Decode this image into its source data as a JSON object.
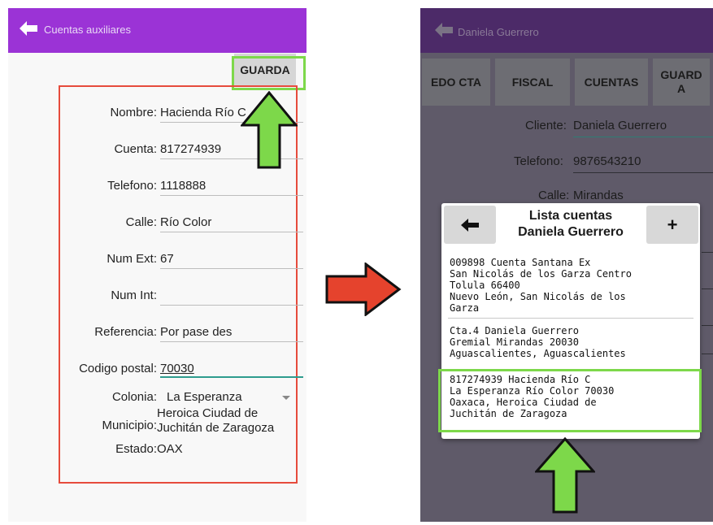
{
  "left_screen": {
    "title": "Cuentas auxiliares",
    "save_button": "GUARDA",
    "fields": [
      {
        "label": "Nombre:",
        "value": "Hacienda Río C"
      },
      {
        "label": "Cuenta:",
        "value": "817274939"
      },
      {
        "label": "Telefono:",
        "value": "1118888"
      },
      {
        "label": "Calle:",
        "value": "Río Color"
      },
      {
        "label": "Num Ext:",
        "value": "67"
      },
      {
        "label": "Num Int:",
        "value": ""
      },
      {
        "label": "Referencia:",
        "value": "Por pase des"
      },
      {
        "label": "Codigo postal:",
        "value": "70030"
      }
    ],
    "colonia": {
      "label": "Colonia:",
      "value": "La Esperanza"
    },
    "municipio": {
      "label": "Municipio:",
      "value_line1": "Heroica Ciudad de",
      "value_line2": "Juchitán de Zaragoza"
    },
    "estado": {
      "label": "Estado:",
      "value": "OAX"
    }
  },
  "right_screen": {
    "title": "Daniela Guerrero",
    "tabs": [
      "EDO CTA",
      "FISCAL",
      "CUENTAS",
      "GUARD A"
    ],
    "fields": [
      {
        "label": "Cliente:",
        "value": "Daniela Guerrero"
      },
      {
        "label": "Telefono:",
        "value": "9876543210"
      },
      {
        "label": "Calle:",
        "value": "Mirandas"
      }
    ],
    "dialog": {
      "title_line1": "Lista cuentas",
      "title_line2": "Daniela Guerrero",
      "back_icon": "arrow-left-icon",
      "add_label": "+",
      "items": [
        "009898 Cuenta Santana Ex\nSan Nicolás de los Garza Centro\nTolula 66400\nNuevo León, San Nicolás de los\nGarza",
        "Cta.4 Daniela Guerrero\nGremial Mirandas 20030\nAguascalientes, Aguascalientes",
        "817274939 Hacienda Río C\nLa Esperanza Río Color 70030\nOaxaca, Heroica Ciudad de\nJuchitán de Zaragoza"
      ]
    }
  },
  "colors": {
    "purple": "#9b33d6",
    "highlight_green": "#7dd84a",
    "form_border_red": "#e64b3c",
    "arrow_red": "#e5432d"
  }
}
